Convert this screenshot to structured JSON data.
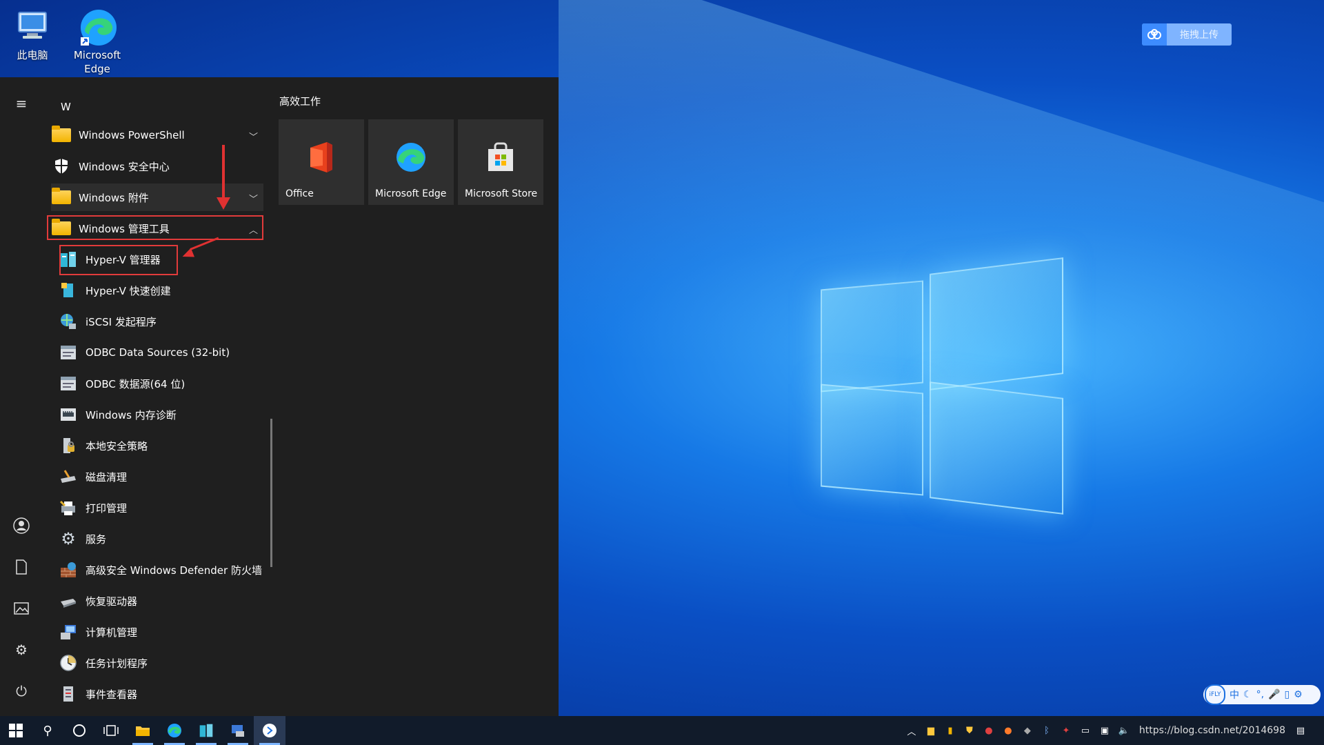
{
  "desktop": {
    "icons": [
      {
        "label": "此电脑"
      },
      {
        "label": "Microsoft Edge"
      }
    ],
    "cloud_upload_label": "拖拽上传"
  },
  "start_menu": {
    "section_letter": "W",
    "items": [
      {
        "label": "Windows PowerShell",
        "icon": "folder-icon",
        "expandable": true,
        "expanded": false
      },
      {
        "label": "Windows 安全中心",
        "icon": "shield-icon"
      },
      {
        "label": "Windows 附件",
        "icon": "folder-icon",
        "expandable": true,
        "expanded": false
      },
      {
        "label": "Windows 管理工具",
        "icon": "folder-icon",
        "expandable": true,
        "expanded": true
      },
      {
        "label": "Hyper-V 管理器",
        "icon": "hyperv-manager-icon"
      },
      {
        "label": "Hyper-V 快速创建",
        "icon": "hyperv-quick-create-icon"
      },
      {
        "label": "iSCSI 发起程序",
        "icon": "iscsi-icon"
      },
      {
        "label": "ODBC Data Sources (32-bit)",
        "icon": "odbc-icon"
      },
      {
        "label": "ODBC 数据源(64 位)",
        "icon": "odbc-icon"
      },
      {
        "label": "Windows 内存诊断",
        "icon": "memory-diagnostic-icon"
      },
      {
        "label": "本地安全策略",
        "icon": "security-policy-icon"
      },
      {
        "label": "磁盘清理",
        "icon": "disk-cleanup-icon"
      },
      {
        "label": "打印管理",
        "icon": "print-management-icon"
      },
      {
        "label": "服务",
        "icon": "services-gear-icon"
      },
      {
        "label": "高级安全 Windows Defender 防火墙",
        "icon": "firewall-icon"
      },
      {
        "label": "恢复驱动器",
        "icon": "recovery-drive-icon"
      },
      {
        "label": "计算机管理",
        "icon": "computer-management-icon"
      },
      {
        "label": "任务计划程序",
        "icon": "task-scheduler-icon"
      },
      {
        "label": "事件查看器",
        "icon": "event-viewer-icon"
      }
    ],
    "tiles_group_title": "高效工作",
    "tiles": [
      {
        "label": "Office",
        "icon": "office-icon"
      },
      {
        "label": "Microsoft Edge",
        "icon": "edge-icon"
      },
      {
        "label": "Microsoft Store",
        "icon": "store-icon"
      }
    ],
    "rail": [
      "hamburger-icon",
      "user-icon",
      "documents-icon",
      "pictures-icon",
      "settings-icon",
      "power-icon"
    ]
  },
  "ime_bar": {
    "brand": "iFLY",
    "mode": "中"
  },
  "taskbar": {
    "url_overlay": "https://blog.csdn.net/2014698"
  },
  "colors": {
    "highlight_box": "#e23b3b",
    "start_bg": "#1f1f1f",
    "taskbar_bg": "#111b2a"
  }
}
